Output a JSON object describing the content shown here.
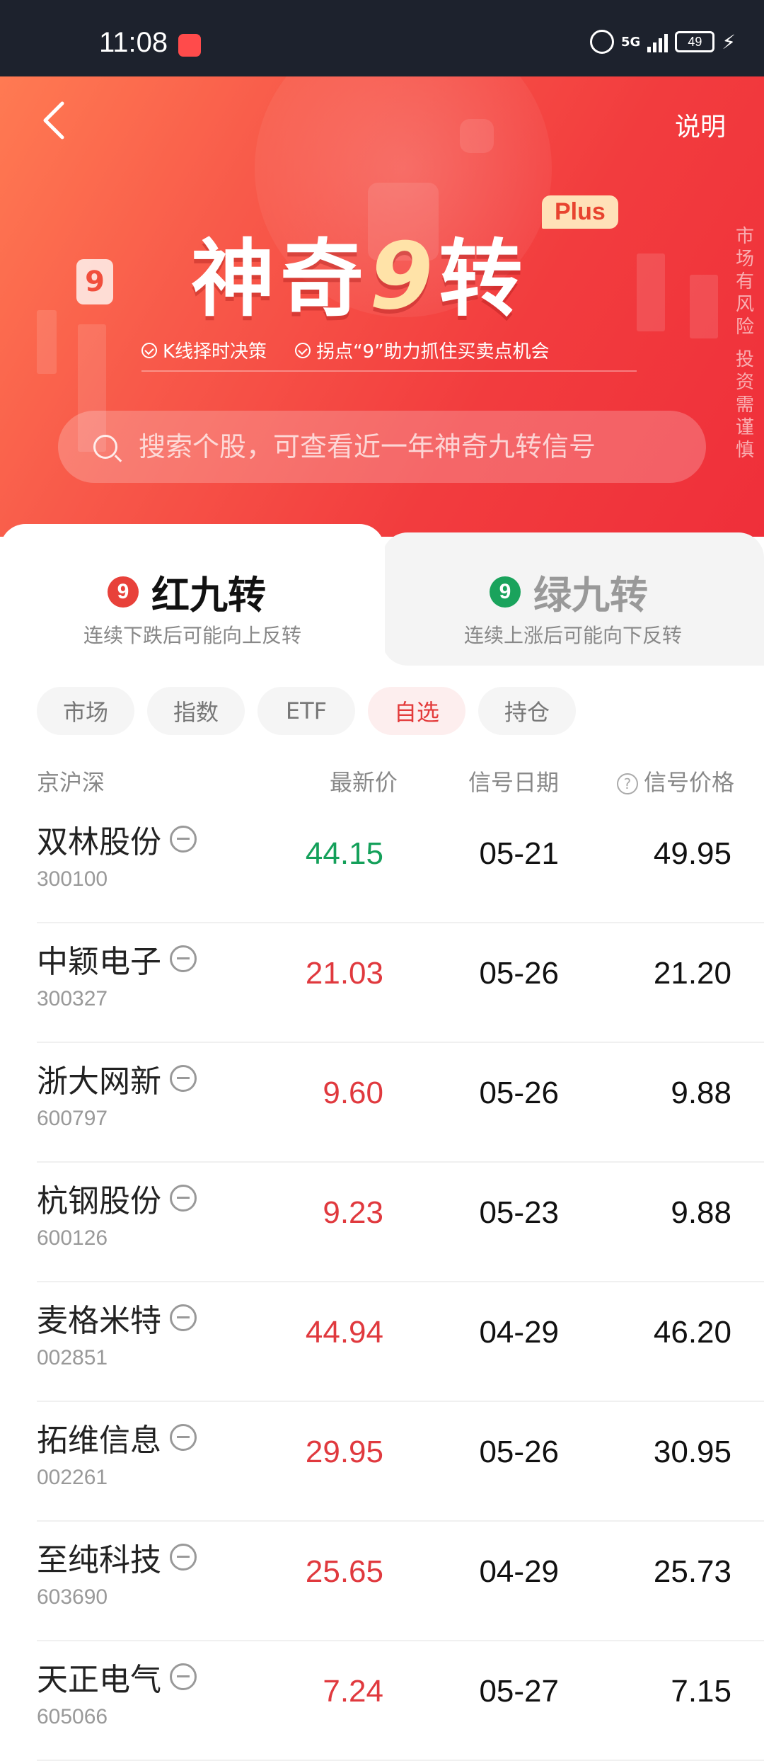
{
  "status_bar": {
    "time": "11:08",
    "network": "5G",
    "battery": "49"
  },
  "header": {
    "help_label": "说明"
  },
  "hero": {
    "title_part1": "神奇",
    "title_nine": "9",
    "title_part2": "转",
    "badge": "Plus",
    "features": [
      "K线择时决策",
      "拐点“9”助力抓住买卖点机会"
    ],
    "side_note": [
      "市",
      "场",
      "有",
      "风",
      "险",
      "投",
      "资",
      "需",
      "谨",
      "慎"
    ],
    "deco_badge": "9"
  },
  "search": {
    "placeholder": "搜索个股，可查看近一年神奇九转信号"
  },
  "tabs": [
    {
      "icon_text": "9",
      "title": "红九转",
      "subtitle": "连续下跌后可能向上反转",
      "color": "#e8413a"
    },
    {
      "icon_text": "9",
      "title": "绿九转",
      "subtitle": "连续上涨后可能向下反转",
      "color": "#1aa35c"
    }
  ],
  "filters": [
    {
      "label": "市场",
      "active": false
    },
    {
      "label": "指数",
      "active": false
    },
    {
      "label": "ETF",
      "active": false
    },
    {
      "label": "自选",
      "active": true
    },
    {
      "label": "持仓",
      "active": false
    }
  ],
  "table": {
    "headers": {
      "market": "京沪深",
      "latest": "最新价",
      "date": "信号日期",
      "help": "?",
      "signal_price": "信号价格"
    },
    "colors": {
      "up": "#e0393e",
      "down": "#14a05a"
    },
    "rows": [
      {
        "name": "双林股份",
        "code": "300100",
        "price": "44.15",
        "trend": "down",
        "date": "05-21",
        "signal_price": "49.95"
      },
      {
        "name": "中颖电子",
        "code": "300327",
        "price": "21.03",
        "trend": "up",
        "date": "05-26",
        "signal_price": "21.20"
      },
      {
        "name": "浙大网新",
        "code": "600797",
        "price": "9.60",
        "trend": "up",
        "date": "05-26",
        "signal_price": "9.88"
      },
      {
        "name": "杭钢股份",
        "code": "600126",
        "price": "9.23",
        "trend": "up",
        "date": "05-23",
        "signal_price": "9.88"
      },
      {
        "name": "麦格米特",
        "code": "002851",
        "price": "44.94",
        "trend": "up",
        "date": "04-29",
        "signal_price": "46.20"
      },
      {
        "name": "拓维信息",
        "code": "002261",
        "price": "29.95",
        "trend": "up",
        "date": "05-26",
        "signal_price": "30.95"
      },
      {
        "name": "至纯科技",
        "code": "603690",
        "price": "25.65",
        "trend": "up",
        "date": "04-29",
        "signal_price": "25.73"
      },
      {
        "name": "天正电气",
        "code": "605066",
        "price": "7.24",
        "trend": "up",
        "date": "05-27",
        "signal_price": "7.15"
      }
    ]
  }
}
